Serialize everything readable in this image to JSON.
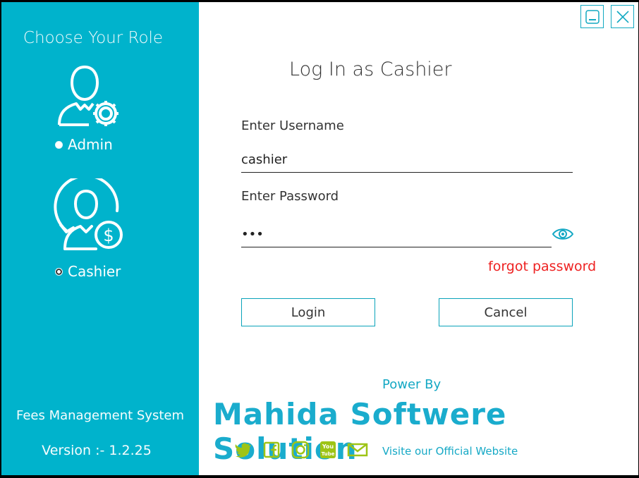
{
  "sidebar": {
    "title": "Choose Your Role",
    "roles": [
      {
        "label": "Admin",
        "selected": false
      },
      {
        "label": "Cashier",
        "selected": true
      }
    ],
    "app_name": "Fees Management System",
    "version": "Version :- 1.2.25"
  },
  "form": {
    "title": "Log In as Cashier",
    "username_label": "Enter Username",
    "username_value": "cashier",
    "password_label": "Enter Password",
    "password_value": "•••",
    "forgot_label": "forgot password",
    "login_label": "Login",
    "cancel_label": "Cancel"
  },
  "footer": {
    "powered_by": "Power By",
    "brand": "Mahida Softwere Solution",
    "website_label": "Visite our Official Website",
    "social_icons": [
      "twitter-icon",
      "facebook-icon",
      "instagram-icon",
      "youtube-icon",
      "mail-icon"
    ]
  },
  "colors": {
    "sidebar": "#00b3cc",
    "accent": "#1aaccd",
    "social": "#9ec416",
    "forgot": "#ee2222"
  }
}
